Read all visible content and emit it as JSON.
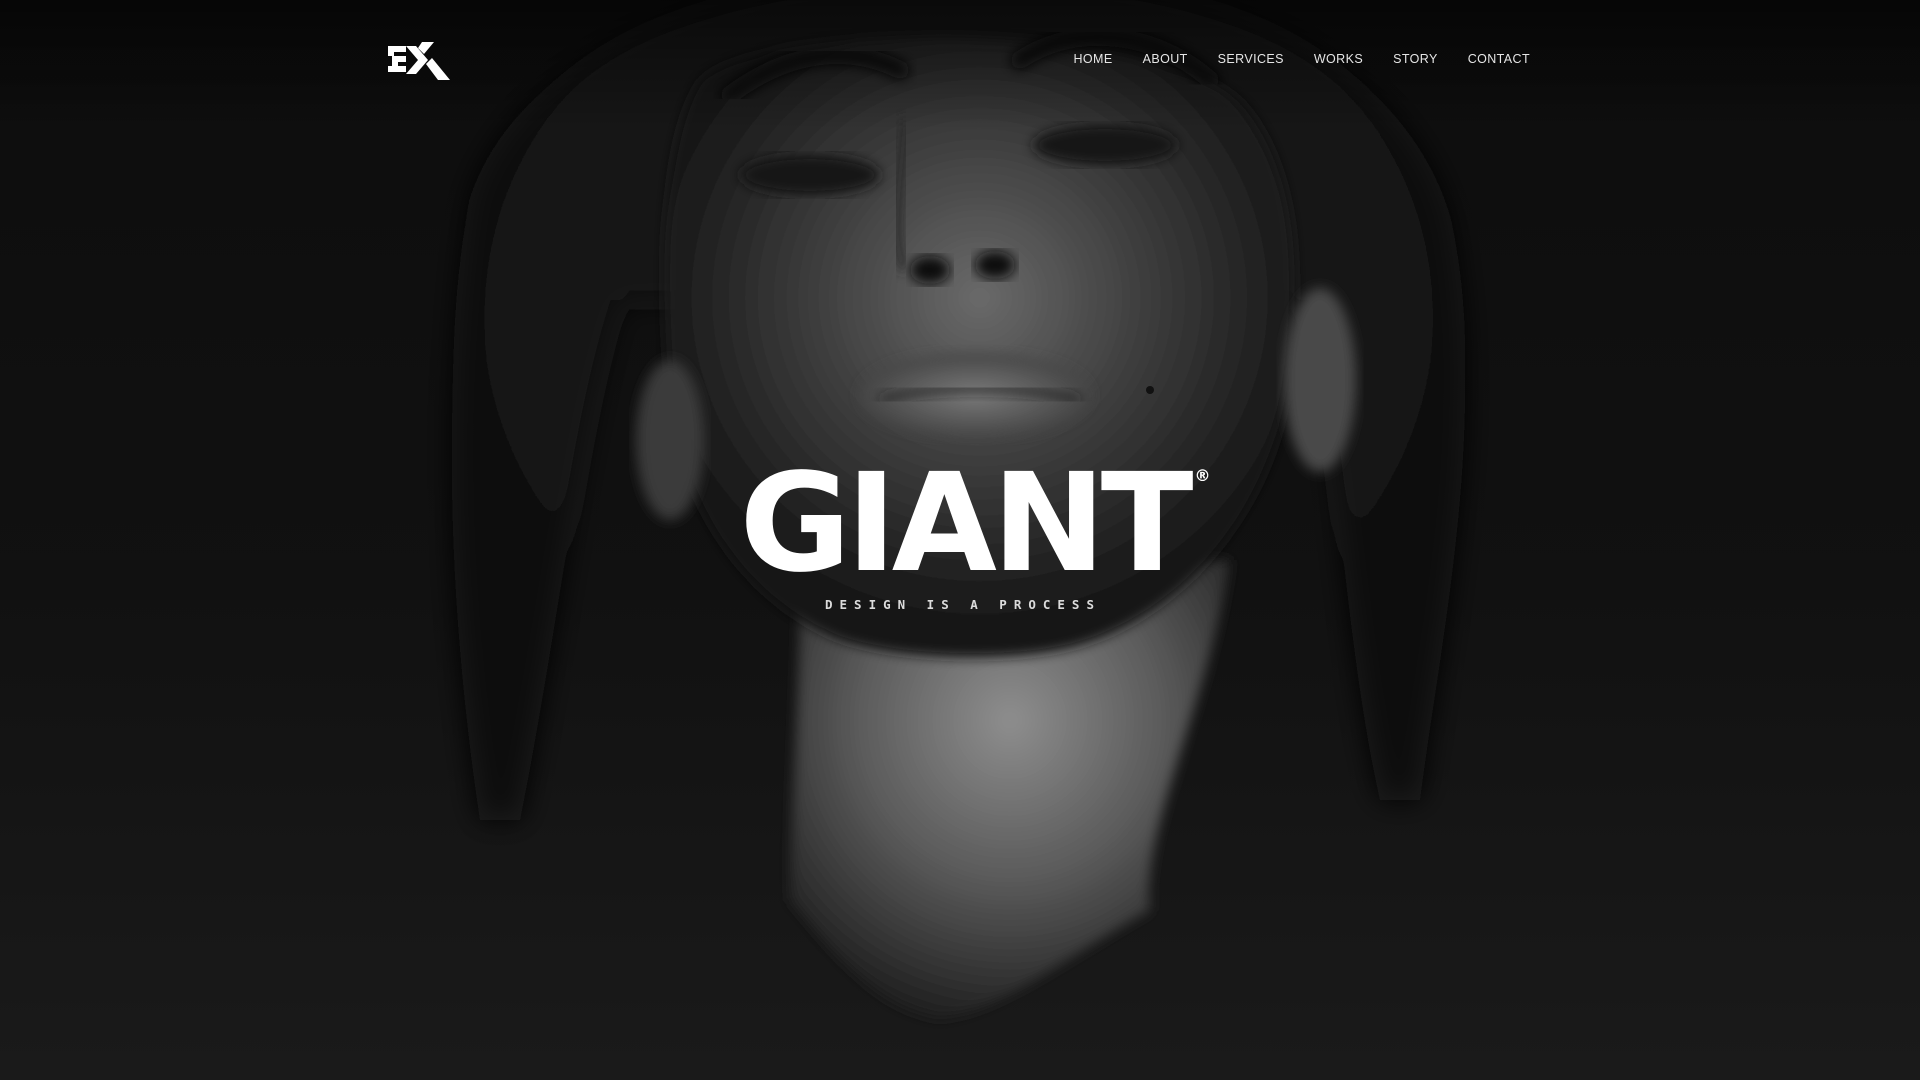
{
  "header": {
    "logo_text": "EX",
    "nav": [
      {
        "label": "HOME"
      },
      {
        "label": "ABOUT"
      },
      {
        "label": "SERVICES"
      },
      {
        "label": "WORKS"
      },
      {
        "label": "STORY"
      },
      {
        "label": "CONTACT"
      }
    ]
  },
  "hero": {
    "title": "GIANT",
    "registered_mark": "®",
    "tagline": "DESIGN IS A PROCESS",
    "background_photo": "black-and-white portrait of a woman's face"
  },
  "colors": {
    "background": "#121212",
    "text": "#ffffff",
    "nav_text": "#e6e6e6"
  }
}
